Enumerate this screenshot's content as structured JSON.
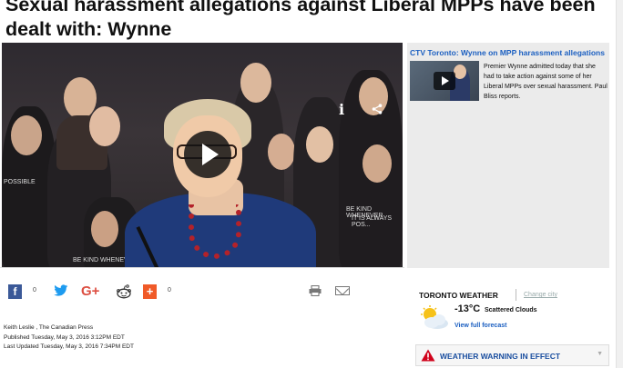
{
  "article": {
    "headline": "Sexual harassment allegations against Liberal MPPs have been dealt with: Wynne",
    "byline_author": "Keith Leslie , The Canadian Press",
    "published": "Published Tuesday, May 3, 2016 3:12PM EDT",
    "updated": "Last Updated Tuesday, May 3, 2016 7:34PM EDT"
  },
  "video": {
    "info_glyph": "i",
    "sign_texts": [
      "BE KIND WHENEVER",
      "IT IS ALWAYS POS...",
      "POSSIBLE",
      "BE KIND WHENEVER"
    ]
  },
  "related": {
    "title": "CTV Toronto: Wynne on MPP harassment allegations",
    "description": "Premier Wynne admitted today that she had to take action against some of her Liberal MPPs over sexual harassment. Paul Bliss reports."
  },
  "social": {
    "facebook_glyph": "f",
    "facebook_count": "0",
    "googleplus_glyph": "G+",
    "plus_glyph": "+",
    "plus_count": "0"
  },
  "weather": {
    "title": "TORONTO WEATHER",
    "change_city": "Change city",
    "temperature": "-13°C",
    "condition": "Scattered Clouds",
    "forecast_link": "View full forecast",
    "warning": "WEATHER WARNING IN EFFECT"
  },
  "colors": {
    "link_blue": "#1b5fc1",
    "warning_red": "#d0021b",
    "facebook": "#3b5998",
    "twitter": "#1d9bf0",
    "googleplus": "#dc4e41",
    "addthis": "#f05a28"
  }
}
